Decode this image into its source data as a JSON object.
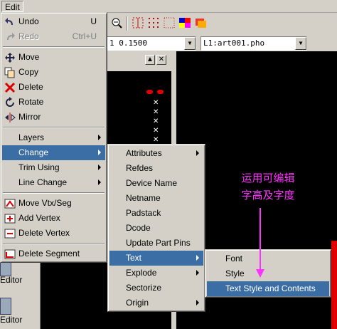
{
  "menubar": {
    "edit_label": "Edit"
  },
  "combos": {
    "layer_value": "1 0.1500",
    "file_value": "L1:art001.pho"
  },
  "small_buttons": {
    "up": "▲",
    "close": "✕"
  },
  "left_panel": {
    "editor_label_1": "Editor",
    "editor_label_2": "Editor"
  },
  "edit_menu": {
    "items": [
      {
        "label": "Undo",
        "shortcut": "U",
        "icon": "undo-icon"
      },
      {
        "label": "Redo",
        "shortcut": "Ctrl+U",
        "icon": "redo-icon"
      },
      {
        "label": "Move",
        "icon": "move-icon"
      },
      {
        "label": "Copy",
        "icon": "copy-icon"
      },
      {
        "label": "Delete",
        "icon": "delete-icon"
      },
      {
        "label": "Rotate",
        "icon": "rotate-icon"
      },
      {
        "label": "Mirror",
        "icon": "mirror-icon"
      },
      {
        "label": "Layers"
      },
      {
        "label": "Change"
      },
      {
        "label": "Trim Using"
      },
      {
        "label": "Line Change"
      },
      {
        "label": "Move Vtx/Seg",
        "icon": "move-vertex-icon"
      },
      {
        "label": "Add Vertex",
        "icon": "add-vertex-icon"
      },
      {
        "label": "Delete Vertex",
        "icon": "delete-vertex-icon"
      },
      {
        "label": "Delete Segment",
        "icon": "delete-segment-icon"
      }
    ]
  },
  "change_menu": {
    "items": [
      {
        "label": "Attributes"
      },
      {
        "label": "Refdes"
      },
      {
        "label": "Device Name"
      },
      {
        "label": "Netname"
      },
      {
        "label": "Padstack"
      },
      {
        "label": "Dcode"
      },
      {
        "label": "Update Part Pins"
      },
      {
        "label": "Text"
      },
      {
        "label": "Explode"
      },
      {
        "label": "Sectorize"
      },
      {
        "label": "Origin"
      }
    ]
  },
  "text_menu": {
    "items": [
      {
        "label": "Font"
      },
      {
        "label": "Style"
      },
      {
        "label": "Text Style and Contents"
      }
    ]
  },
  "annotation": {
    "line1": "运用可编辑",
    "line2": "字高及字度"
  },
  "colors": {
    "menu_highlight": "#0a246a",
    "annotation": "#ff33ff",
    "canvas": "#000000"
  }
}
